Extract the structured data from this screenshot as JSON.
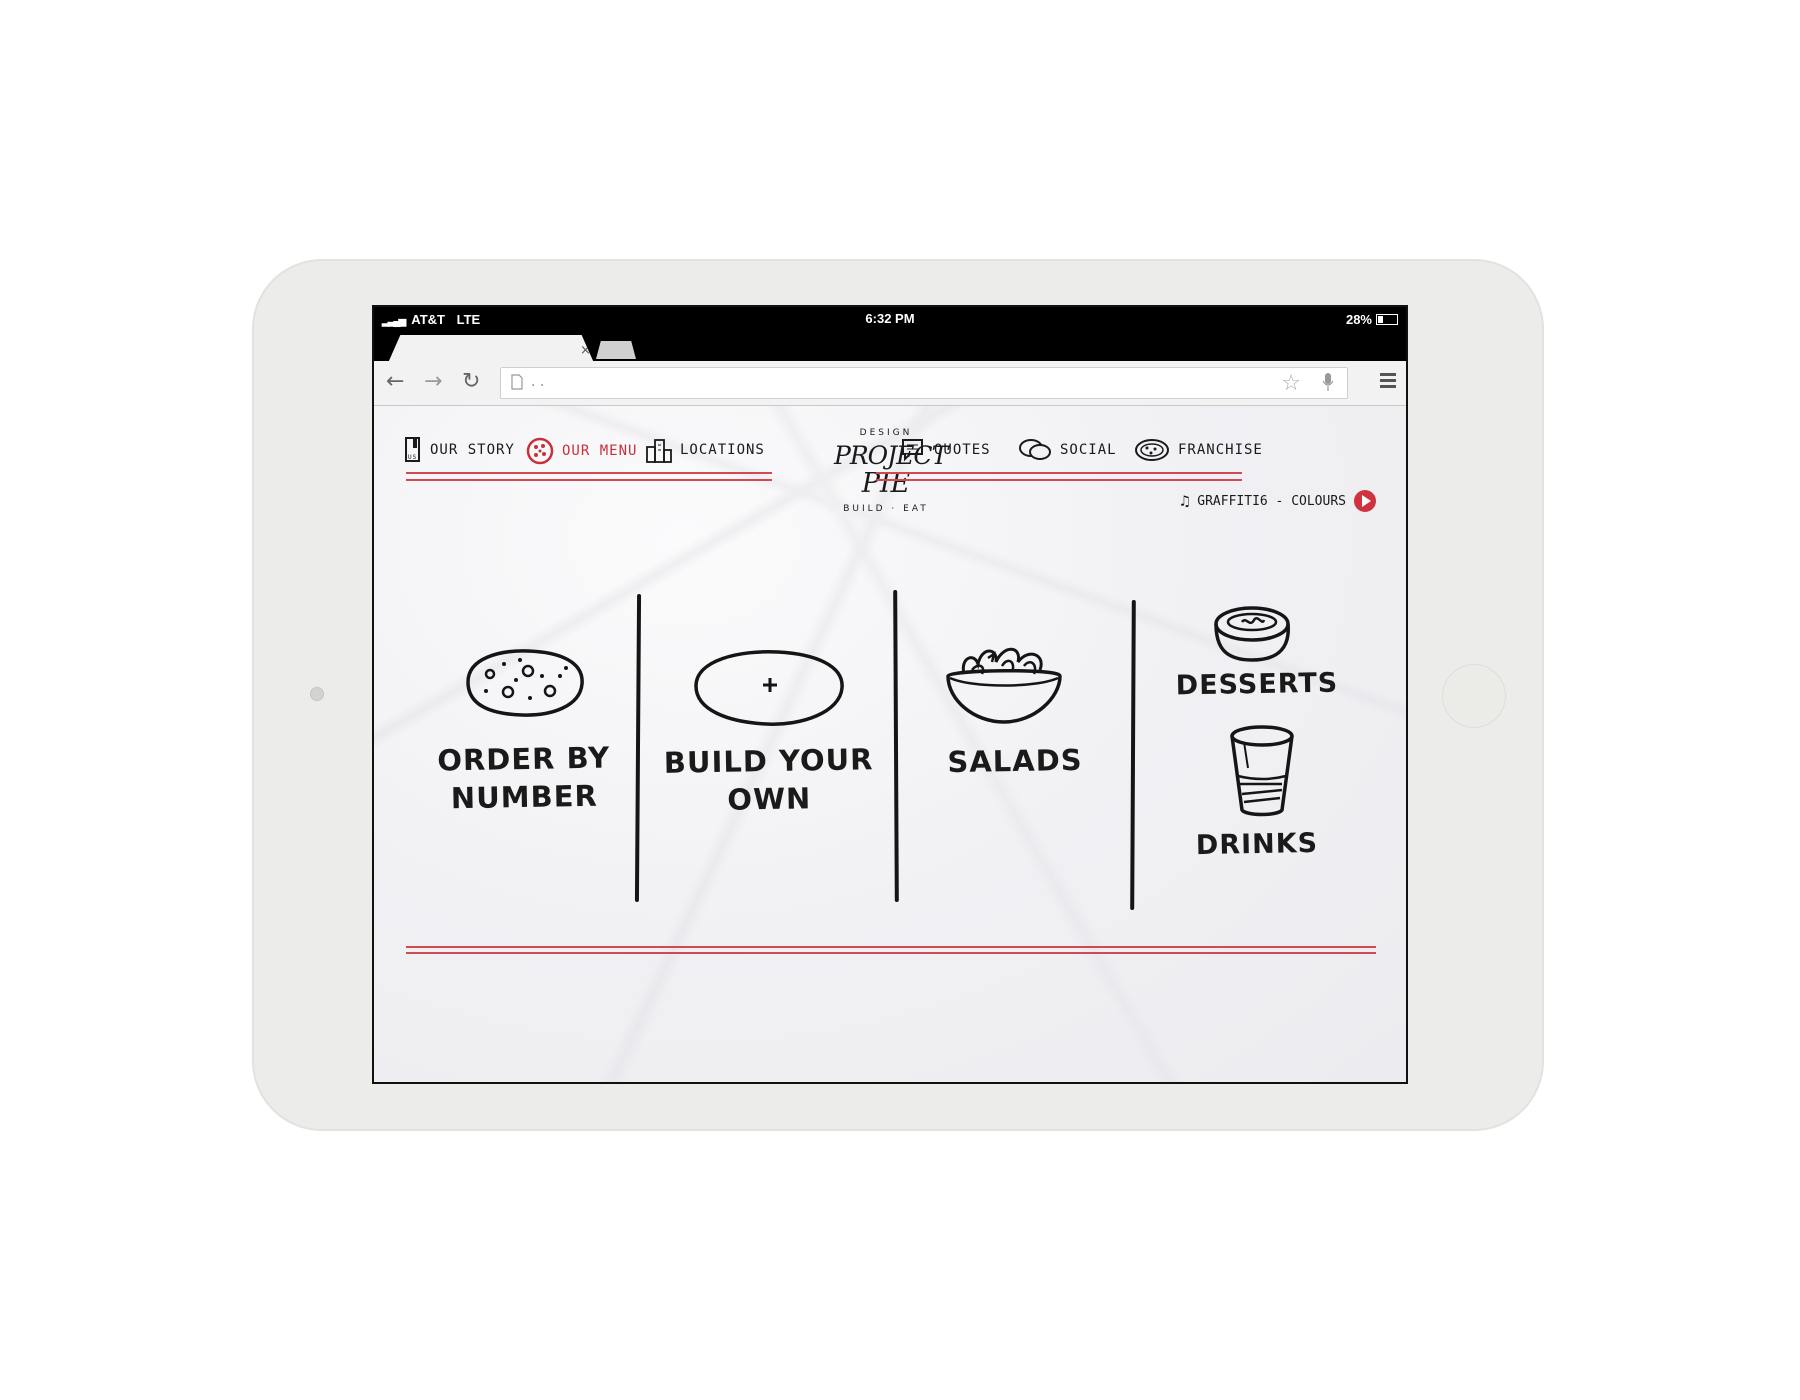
{
  "status_bar": {
    "carrier": "AT&T",
    "network": "LTE",
    "time": "6:32 PM",
    "battery": "28%",
    "battery_level": 0.28
  },
  "browser": {
    "tab_close": "×",
    "url": ". ."
  },
  "nav": {
    "items": [
      {
        "label": "OUR STORY",
        "icon": "book-icon"
      },
      {
        "label": "OUR MENU",
        "icon": "pizza-icon",
        "active": true
      },
      {
        "label": "LOCATIONS",
        "icon": "buildings-icon"
      },
      {
        "label": "QUOTES",
        "icon": "quote-bubble-icon"
      },
      {
        "label": "SOCIAL",
        "icon": "chat-bubbles-icon"
      },
      {
        "label": "FRANCHISE",
        "icon": "pie-icon"
      }
    ],
    "accent_color": "#c8303a"
  },
  "logo": {
    "top": "DESIGN",
    "line1": "PROJECT",
    "line2": "PIE",
    "bottom": "BUILD · EAT"
  },
  "music": {
    "track": "GRAFFITI6 - COLOURS"
  },
  "menu": {
    "order_by_number": [
      "ORDER BY",
      "NUMBER"
    ],
    "build_your_own": [
      "BUILD YOUR",
      "OWN"
    ],
    "salads": "SALADS",
    "desserts": "DESSERTS",
    "drinks": "DRINKS"
  }
}
